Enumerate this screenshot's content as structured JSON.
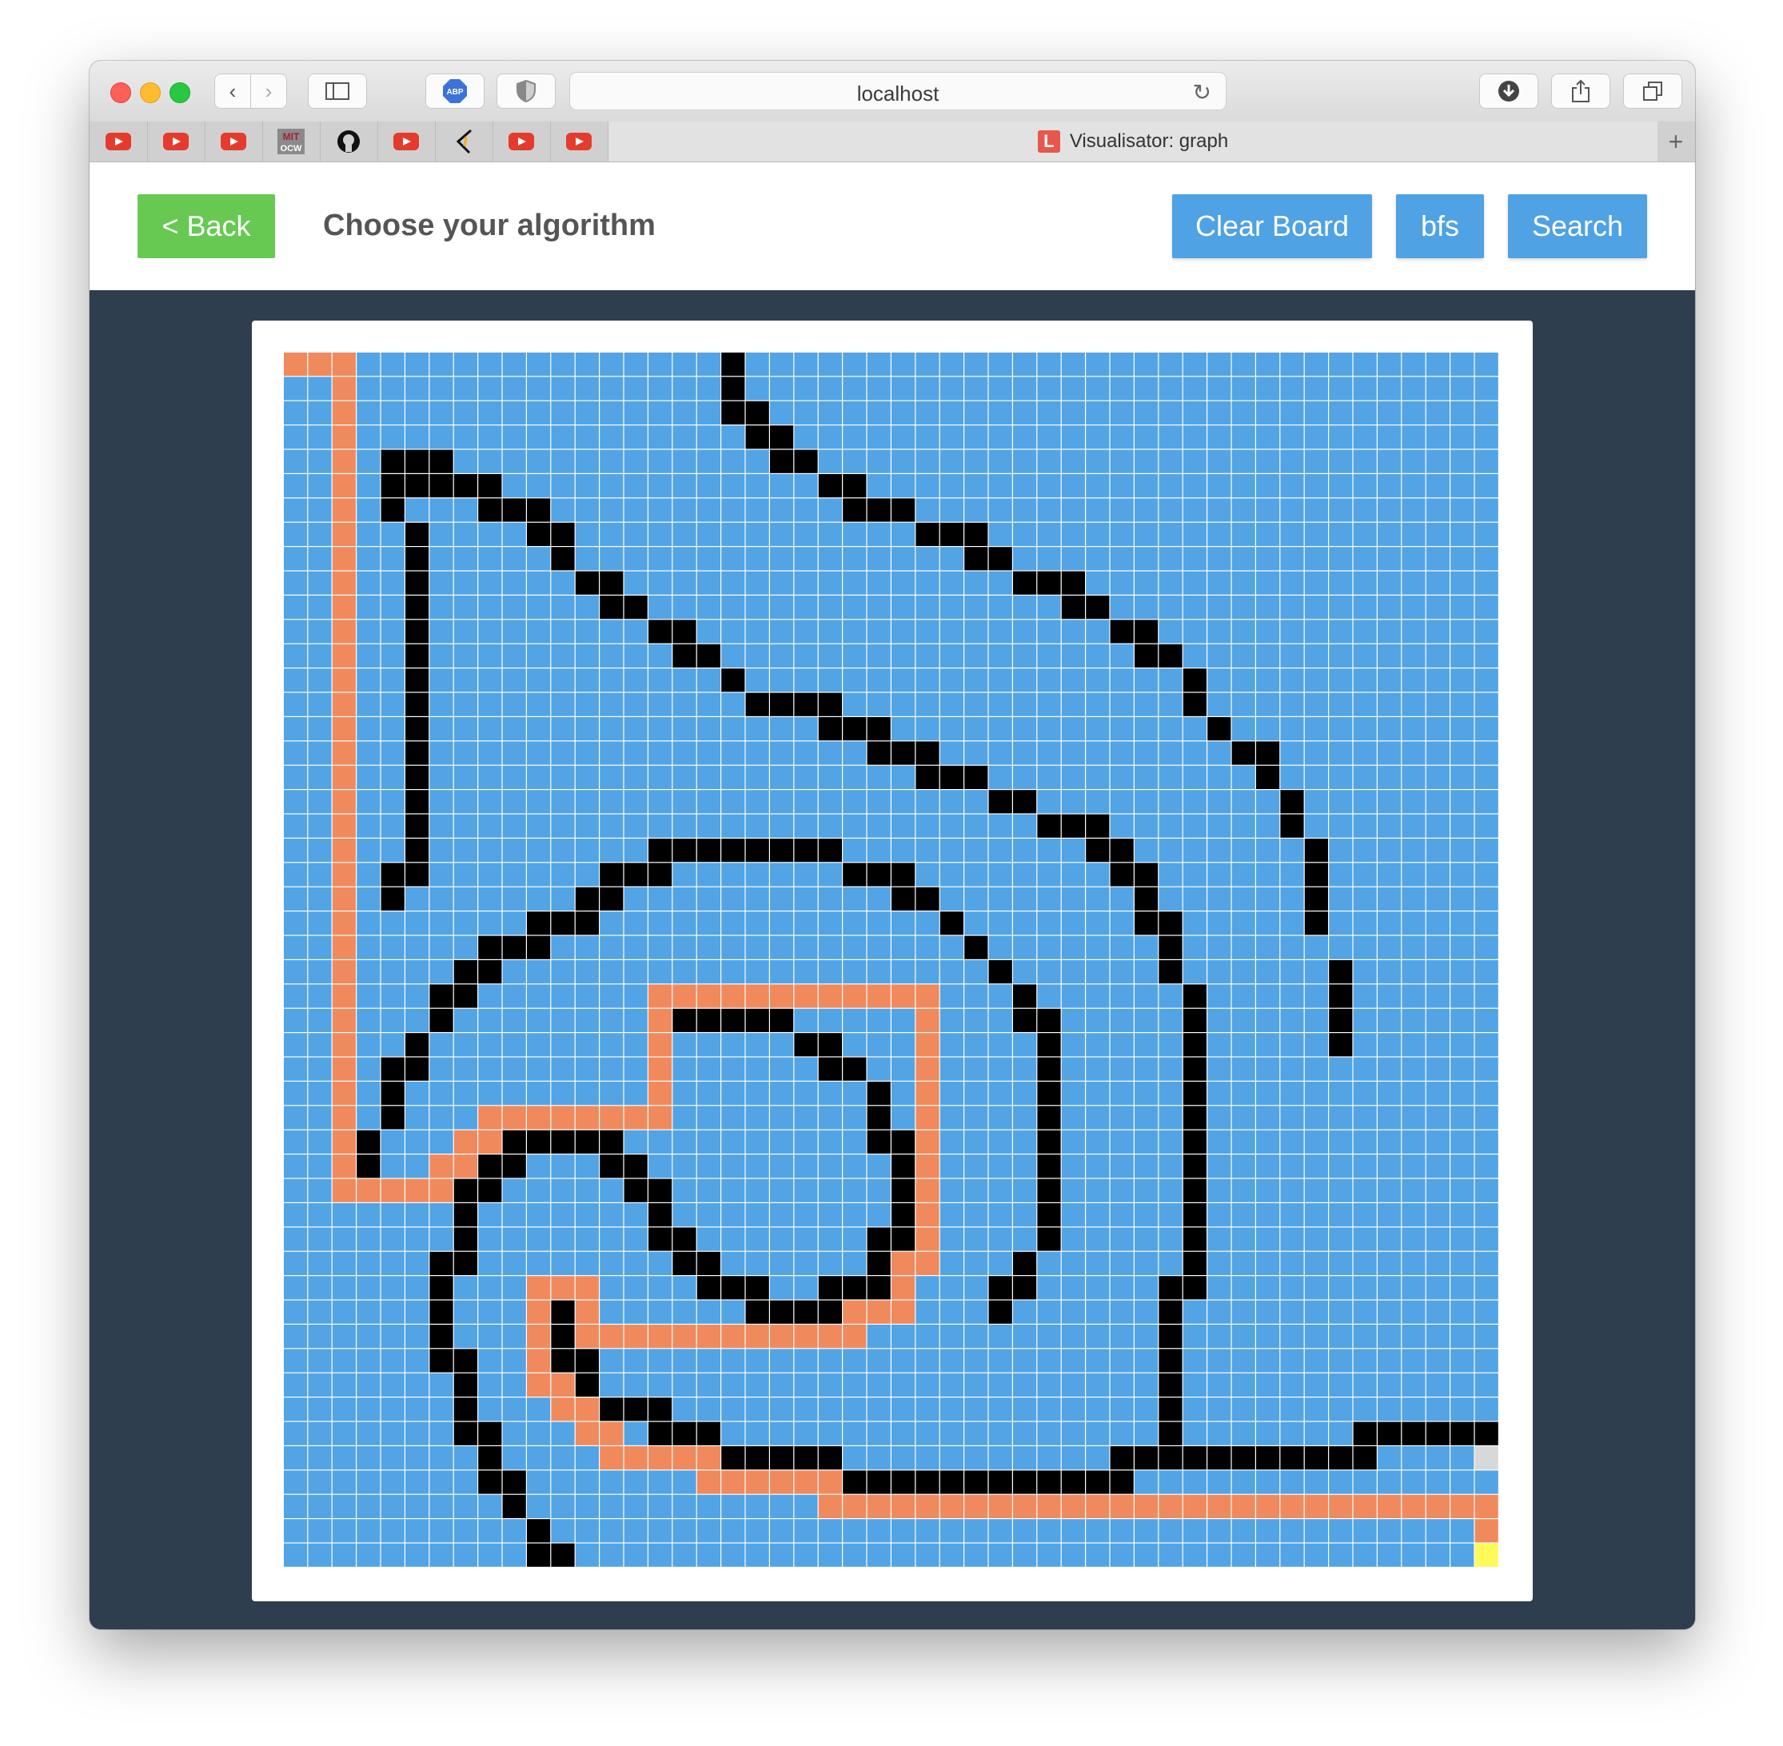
{
  "browser": {
    "url": "localhost",
    "tab_title": "Visualisator: graph",
    "tab_favicon_letter": "L",
    "bookmarks": [
      "youtube-icon",
      "youtube-icon",
      "youtube-icon",
      "mit-ocw-icon",
      "github-icon",
      "youtube-icon",
      "quill-icon",
      "youtube-icon",
      "youtube-icon"
    ],
    "bookmark_mit_text": "MIT OCW"
  },
  "header": {
    "back_label": "< Back",
    "title": "Choose your algorithm",
    "clear_label": "Clear Board",
    "algo_label": "bfs",
    "search_label": "Search"
  },
  "board": {
    "rows": 50,
    "cols": 50,
    "colors": {
      "empty": "#52a4e5",
      "wall": "#000000",
      "path": "#f08a5d",
      "target": "#fdfa5a",
      "visited_end": "#d8d8d8",
      "gridline": "#ffffff"
    },
    "target": [
      49,
      49
    ],
    "end_marker": [
      45,
      49
    ],
    "walls": [
      [
        0,
        18
      ],
      [
        1,
        18
      ],
      [
        2,
        18
      ],
      [
        2,
        19
      ],
      [
        3,
        19
      ],
      [
        3,
        20
      ],
      [
        4,
        4
      ],
      [
        4,
        5
      ],
      [
        4,
        6
      ],
      [
        4,
        20
      ],
      [
        4,
        21
      ],
      [
        5,
        4
      ],
      [
        5,
        5
      ],
      [
        5,
        6
      ],
      [
        5,
        7
      ],
      [
        5,
        8
      ],
      [
        5,
        22
      ],
      [
        5,
        23
      ],
      [
        6,
        4
      ],
      [
        6,
        8
      ],
      [
        6,
        9
      ],
      [
        6,
        10
      ],
      [
        6,
        23
      ],
      [
        6,
        24
      ],
      [
        6,
        25
      ],
      [
        7,
        5
      ],
      [
        7,
        10
      ],
      [
        7,
        11
      ],
      [
        7,
        26
      ],
      [
        7,
        27
      ],
      [
        7,
        28
      ],
      [
        8,
        5
      ],
      [
        8,
        11
      ],
      [
        8,
        28
      ],
      [
        8,
        29
      ],
      [
        9,
        5
      ],
      [
        9,
        12
      ],
      [
        9,
        13
      ],
      [
        9,
        30
      ],
      [
        9,
        31
      ],
      [
        9,
        32
      ],
      [
        10,
        5
      ],
      [
        10,
        13
      ],
      [
        10,
        14
      ],
      [
        10,
        32
      ],
      [
        10,
        33
      ],
      [
        11,
        5
      ],
      [
        11,
        15
      ],
      [
        11,
        16
      ],
      [
        11,
        34
      ],
      [
        11,
        35
      ],
      [
        12,
        5
      ],
      [
        12,
        16
      ],
      [
        12,
        17
      ],
      [
        12,
        35
      ],
      [
        12,
        36
      ],
      [
        13,
        5
      ],
      [
        13,
        18
      ],
      [
        13,
        37
      ],
      [
        14,
        5
      ],
      [
        14,
        19
      ],
      [
        14,
        20
      ],
      [
        14,
        21
      ],
      [
        14,
        22
      ],
      [
        14,
        37
      ],
      [
        15,
        5
      ],
      [
        15,
        22
      ],
      [
        15,
        23
      ],
      [
        15,
        24
      ],
      [
        15,
        38
      ],
      [
        16,
        5
      ],
      [
        16,
        24
      ],
      [
        16,
        25
      ],
      [
        16,
        26
      ],
      [
        16,
        39
      ],
      [
        16,
        40
      ],
      [
        17,
        5
      ],
      [
        17,
        26
      ],
      [
        17,
        27
      ],
      [
        17,
        28
      ],
      [
        17,
        40
      ],
      [
        18,
        5
      ],
      [
        18,
        29
      ],
      [
        18,
        30
      ],
      [
        18,
        41
      ],
      [
        19,
        5
      ],
      [
        19,
        31
      ],
      [
        19,
        32
      ],
      [
        19,
        33
      ],
      [
        19,
        41
      ],
      [
        20,
        5
      ],
      [
        20,
        15
      ],
      [
        20,
        16
      ],
      [
        20,
        17
      ],
      [
        20,
        18
      ],
      [
        20,
        19
      ],
      [
        20,
        20
      ],
      [
        20,
        21
      ],
      [
        20,
        22
      ],
      [
        20,
        33
      ],
      [
        20,
        34
      ],
      [
        20,
        42
      ],
      [
        21,
        4
      ],
      [
        21,
        5
      ],
      [
        21,
        13
      ],
      [
        21,
        14
      ],
      [
        21,
        15
      ],
      [
        21,
        23
      ],
      [
        21,
        24
      ],
      [
        21,
        25
      ],
      [
        21,
        34
      ],
      [
        21,
        35
      ],
      [
        21,
        42
      ],
      [
        22,
        4
      ],
      [
        22,
        12
      ],
      [
        22,
        13
      ],
      [
        22,
        25
      ],
      [
        22,
        26
      ],
      [
        22,
        35
      ],
      [
        22,
        42
      ],
      [
        23,
        10
      ],
      [
        23,
        11
      ],
      [
        23,
        12
      ],
      [
        23,
        27
      ],
      [
        23,
        35
      ],
      [
        23,
        36
      ],
      [
        23,
        42
      ],
      [
        24,
        8
      ],
      [
        24,
        9
      ],
      [
        24,
        10
      ],
      [
        24,
        28
      ],
      [
        24,
        36
      ],
      [
        25,
        7
      ],
      [
        25,
        8
      ],
      [
        25,
        29
      ],
      [
        25,
        36
      ],
      [
        25,
        43
      ],
      [
        26,
        6
      ],
      [
        26,
        7
      ],
      [
        26,
        30
      ],
      [
        26,
        37
      ],
      [
        26,
        43
      ],
      [
        27,
        6
      ],
      [
        27,
        16
      ],
      [
        27,
        17
      ],
      [
        27,
        18
      ],
      [
        27,
        19
      ],
      [
        27,
        20
      ],
      [
        27,
        30
      ],
      [
        27,
        31
      ],
      [
        27,
        37
      ],
      [
        27,
        43
      ],
      [
        28,
        5
      ],
      [
        28,
        21
      ],
      [
        28,
        22
      ],
      [
        28,
        31
      ],
      [
        28,
        37
      ],
      [
        28,
        43
      ],
      [
        29,
        4
      ],
      [
        29,
        5
      ],
      [
        29,
        22
      ],
      [
        29,
        23
      ],
      [
        29,
        31
      ],
      [
        29,
        37
      ],
      [
        30,
        4
      ],
      [
        30,
        24
      ],
      [
        30,
        31
      ],
      [
        30,
        37
      ],
      [
        31,
        4
      ],
      [
        31,
        24
      ],
      [
        31,
        31
      ],
      [
        31,
        37
      ],
      [
        32,
        3
      ],
      [
        32,
        9
      ],
      [
        32,
        10
      ],
      [
        32,
        11
      ],
      [
        32,
        12
      ],
      [
        32,
        13
      ],
      [
        32,
        24
      ],
      [
        32,
        25
      ],
      [
        32,
        31
      ],
      [
        32,
        37
      ],
      [
        33,
        3
      ],
      [
        33,
        8
      ],
      [
        33,
        9
      ],
      [
        33,
        13
      ],
      [
        33,
        14
      ],
      [
        33,
        25
      ],
      [
        33,
        31
      ],
      [
        33,
        37
      ],
      [
        34,
        7
      ],
      [
        34,
        8
      ],
      [
        34,
        14
      ],
      [
        34,
        15
      ],
      [
        34,
        25
      ],
      [
        34,
        31
      ],
      [
        34,
        37
      ],
      [
        35,
        7
      ],
      [
        35,
        15
      ],
      [
        35,
        25
      ],
      [
        35,
        31
      ],
      [
        35,
        37
      ],
      [
        36,
        7
      ],
      [
        36,
        15
      ],
      [
        36,
        16
      ],
      [
        36,
        24
      ],
      [
        36,
        25
      ],
      [
        36,
        31
      ],
      [
        36,
        37
      ],
      [
        37,
        6
      ],
      [
        37,
        7
      ],
      [
        37,
        16
      ],
      [
        37,
        17
      ],
      [
        37,
        24
      ],
      [
        37,
        30
      ],
      [
        37,
        37
      ],
      [
        38,
        6
      ],
      [
        38,
        17
      ],
      [
        38,
        18
      ],
      [
        38,
        19
      ],
      [
        38,
        22
      ],
      [
        38,
        23
      ],
      [
        38,
        24
      ],
      [
        38,
        29
      ],
      [
        38,
        30
      ],
      [
        38,
        36
      ],
      [
        38,
        37
      ],
      [
        39,
        6
      ],
      [
        39,
        11
      ],
      [
        39,
        19
      ],
      [
        39,
        20
      ],
      [
        39,
        21
      ],
      [
        39,
        22
      ],
      [
        39,
        29
      ],
      [
        39,
        36
      ],
      [
        40,
        6
      ],
      [
        40,
        11
      ],
      [
        40,
        36
      ],
      [
        41,
        6
      ],
      [
        41,
        7
      ],
      [
        41,
        11
      ],
      [
        41,
        12
      ],
      [
        41,
        36
      ],
      [
        42,
        7
      ],
      [
        42,
        12
      ],
      [
        42,
        36
      ],
      [
        43,
        7
      ],
      [
        43,
        13
      ],
      [
        43,
        14
      ],
      [
        43,
        15
      ],
      [
        43,
        36
      ],
      [
        44,
        7
      ],
      [
        44,
        8
      ],
      [
        44,
        15
      ],
      [
        44,
        16
      ],
      [
        44,
        17
      ],
      [
        44,
        36
      ],
      [
        44,
        44
      ],
      [
        44,
        45
      ],
      [
        44,
        46
      ],
      [
        44,
        47
      ],
      [
        44,
        48
      ],
      [
        44,
        49
      ],
      [
        45,
        8
      ],
      [
        45,
        18
      ],
      [
        45,
        19
      ],
      [
        45,
        20
      ],
      [
        45,
        21
      ],
      [
        45,
        22
      ],
      [
        45,
        34
      ],
      [
        45,
        35
      ],
      [
        45,
        36
      ],
      [
        45,
        37
      ],
      [
        45,
        38
      ],
      [
        45,
        39
      ],
      [
        45,
        40
      ],
      [
        45,
        41
      ],
      [
        45,
        42
      ],
      [
        45,
        43
      ],
      [
        45,
        44
      ],
      [
        46,
        8
      ],
      [
        46,
        9
      ],
      [
        46,
        23
      ],
      [
        46,
        24
      ],
      [
        46,
        25
      ],
      [
        46,
        26
      ],
      [
        46,
        27
      ],
      [
        46,
        28
      ],
      [
        46,
        29
      ],
      [
        46,
        30
      ],
      [
        46,
        31
      ],
      [
        46,
        32
      ],
      [
        46,
        33
      ],
      [
        46,
        34
      ],
      [
        47,
        9
      ],
      [
        48,
        10
      ],
      [
        49,
        10
      ],
      [
        49,
        11
      ]
    ],
    "path": [
      [
        0,
        0
      ],
      [
        0,
        1
      ],
      [
        0,
        2
      ],
      [
        1,
        2
      ],
      [
        2,
        2
      ],
      [
        3,
        2
      ],
      [
        4,
        2
      ],
      [
        5,
        2
      ],
      [
        6,
        2
      ],
      [
        7,
        2
      ],
      [
        8,
        2
      ],
      [
        9,
        2
      ],
      [
        10,
        2
      ],
      [
        11,
        2
      ],
      [
        12,
        2
      ],
      [
        13,
        2
      ],
      [
        14,
        2
      ],
      [
        15,
        2
      ],
      [
        16,
        2
      ],
      [
        17,
        2
      ],
      [
        18,
        2
      ],
      [
        19,
        2
      ],
      [
        20,
        2
      ],
      [
        21,
        2
      ],
      [
        22,
        2
      ],
      [
        23,
        2
      ],
      [
        24,
        2
      ],
      [
        25,
        2
      ],
      [
        26,
        2
      ],
      [
        27,
        2
      ],
      [
        28,
        2
      ],
      [
        29,
        2
      ],
      [
        30,
        2
      ],
      [
        31,
        2
      ],
      [
        32,
        2
      ],
      [
        33,
        2
      ],
      [
        34,
        2
      ],
      [
        34,
        3
      ],
      [
        34,
        4
      ],
      [
        34,
        5
      ],
      [
        34,
        6
      ],
      [
        33,
        6
      ],
      [
        33,
        7
      ],
      [
        32,
        7
      ],
      [
        32,
        8
      ],
      [
        31,
        8
      ],
      [
        31,
        9
      ],
      [
        31,
        10
      ],
      [
        31,
        11
      ],
      [
        31,
        12
      ],
      [
        31,
        13
      ],
      [
        31,
        14
      ],
      [
        31,
        15
      ],
      [
        30,
        15
      ],
      [
        29,
        15
      ],
      [
        28,
        15
      ],
      [
        27,
        15
      ],
      [
        26,
        15
      ],
      [
        26,
        16
      ],
      [
        26,
        17
      ],
      [
        26,
        18
      ],
      [
        26,
        19
      ],
      [
        26,
        20
      ],
      [
        26,
        21
      ],
      [
        26,
        22
      ],
      [
        26,
        23
      ],
      [
        26,
        24
      ],
      [
        26,
        25
      ],
      [
        26,
        26
      ],
      [
        27,
        26
      ],
      [
        28,
        26
      ],
      [
        29,
        26
      ],
      [
        30,
        26
      ],
      [
        31,
        26
      ],
      [
        32,
        26
      ],
      [
        33,
        26
      ],
      [
        34,
        26
      ],
      [
        35,
        26
      ],
      [
        36,
        26
      ],
      [
        37,
        26
      ],
      [
        37,
        25
      ],
      [
        38,
        25
      ],
      [
        39,
        25
      ],
      [
        39,
        24
      ],
      [
        39,
        23
      ],
      [
        40,
        23
      ],
      [
        40,
        22
      ],
      [
        40,
        21
      ],
      [
        40,
        20
      ],
      [
        40,
        19
      ],
      [
        40,
        18
      ],
      [
        40,
        17
      ],
      [
        40,
        16
      ],
      [
        40,
        15
      ],
      [
        40,
        14
      ],
      [
        40,
        13
      ],
      [
        40,
        12
      ],
      [
        39,
        12
      ],
      [
        38,
        12
      ],
      [
        38,
        11
      ],
      [
        38,
        10
      ],
      [
        39,
        10
      ],
      [
        40,
        10
      ],
      [
        41,
        10
      ],
      [
        42,
        10
      ],
      [
        42,
        11
      ],
      [
        43,
        11
      ],
      [
        43,
        12
      ],
      [
        44,
        12
      ],
      [
        44,
        13
      ],
      [
        45,
        13
      ],
      [
        45,
        14
      ],
      [
        45,
        15
      ],
      [
        45,
        16
      ],
      [
        45,
        17
      ],
      [
        46,
        17
      ],
      [
        46,
        18
      ],
      [
        46,
        19
      ],
      [
        46,
        20
      ],
      [
        46,
        21
      ],
      [
        46,
        22
      ],
      [
        47,
        22
      ],
      [
        47,
        23
      ],
      [
        47,
        24
      ],
      [
        47,
        25
      ],
      [
        47,
        26
      ],
      [
        47,
        27
      ],
      [
        47,
        28
      ],
      [
        47,
        29
      ],
      [
        47,
        30
      ],
      [
        47,
        31
      ],
      [
        47,
        32
      ],
      [
        47,
        33
      ],
      [
        47,
        34
      ],
      [
        47,
        35
      ],
      [
        47,
        36
      ],
      [
        47,
        37
      ],
      [
        47,
        38
      ],
      [
        47,
        39
      ],
      [
        47,
        40
      ],
      [
        47,
        41
      ],
      [
        47,
        42
      ],
      [
        47,
        43
      ],
      [
        47,
        44
      ],
      [
        47,
        45
      ],
      [
        47,
        46
      ],
      [
        47,
        47
      ],
      [
        47,
        48
      ],
      [
        47,
        49
      ],
      [
        48,
        49
      ]
    ]
  }
}
